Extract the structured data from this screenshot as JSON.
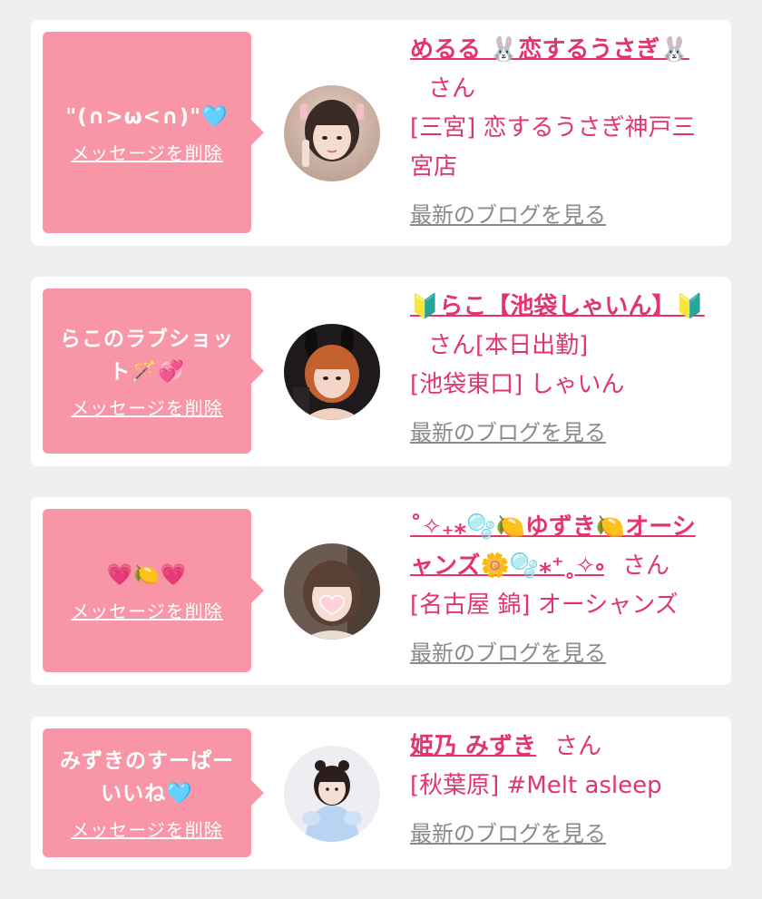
{
  "favorites": [
    {
      "message": "\"(∩>ω<∩)\"🩵",
      "delete_label": "メッセージを削除",
      "name": "めるる 🐰恋するうさぎ🐰",
      "honorific": "さん",
      "status": "",
      "shop": "[三宮] 恋するうさぎ神戸三宮店",
      "blog_label": "最新のブログを見る"
    },
    {
      "message": "らこのラブショット🪄💞",
      "delete_label": "メッセージを削除",
      "name": "🔰らこ【池袋しゃいん】🔰",
      "honorific": "さん",
      "status": "[本日出勤]",
      "shop": "[池袋東口] しゃいん",
      "blog_label": "最新のブログを見る"
    },
    {
      "message": "💗🍋💗",
      "delete_label": "メッセージを削除",
      "name": "˚✧₊⁎🫧🍋ゆずき🍋オーシャンズ🌼🫧⁎⁺˳✧༚",
      "honorific": "さん",
      "status": "",
      "shop": "[名古屋 錦] オーシャンズ",
      "blog_label": "最新のブログを見る"
    },
    {
      "message": "みずきのすーぱーいいね🩵",
      "delete_label": "メッセージを削除",
      "name": "姫乃 みずき",
      "honorific": "さん",
      "status": "",
      "shop": "[秋葉原] #Melt asleep",
      "blog_label": "最新のブログを見る"
    }
  ],
  "colors": {
    "accent": "#e2356f",
    "bubble": "#f895a6",
    "background": "#efeff1",
    "link_gray": "#8a8a8a"
  }
}
